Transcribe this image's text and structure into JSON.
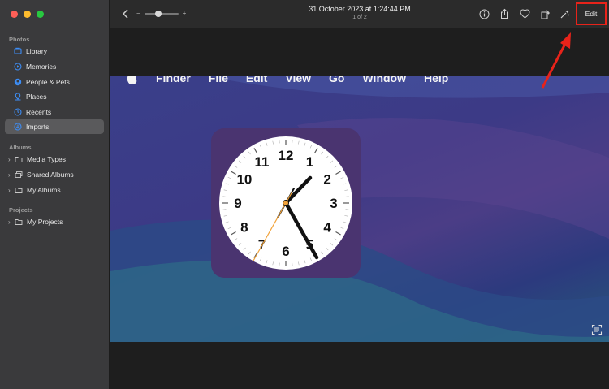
{
  "sidebar": {
    "sections": {
      "photos": "Photos",
      "albums": "Albums",
      "projects": "Projects"
    },
    "photo_items": [
      {
        "label": "Library",
        "icon": "library-icon"
      },
      {
        "label": "Memories",
        "icon": "memories-icon"
      },
      {
        "label": "People & Pets",
        "icon": "people-icon"
      },
      {
        "label": "Places",
        "icon": "places-icon"
      },
      {
        "label": "Recents",
        "icon": "recents-icon"
      },
      {
        "label": "Imports",
        "icon": "imports-icon",
        "selected": true
      }
    ],
    "album_items": [
      {
        "label": "Media Types"
      },
      {
        "label": "Shared Albums"
      },
      {
        "label": "My Albums"
      }
    ],
    "project_items": [
      {
        "label": "My Projects"
      }
    ]
  },
  "toolbar": {
    "zoom_minus": "−",
    "zoom_plus": "+",
    "date": "31 October 2023 at 1:24:44 PM",
    "count": "1 of 2",
    "edit_label": "Edit"
  },
  "photo": {
    "menubar": [
      "Finder",
      "File",
      "Edit",
      "View",
      "Go",
      "Window",
      "Help"
    ],
    "clock_numbers": [
      "12",
      "1",
      "2",
      "3",
      "4",
      "5",
      "6",
      "7",
      "8",
      "9",
      "10",
      "11"
    ]
  },
  "colors": {
    "highlight": "#e8231a",
    "sidebar_bg": "#3a3a3c",
    "accent_blue": "#3d8ef7"
  }
}
